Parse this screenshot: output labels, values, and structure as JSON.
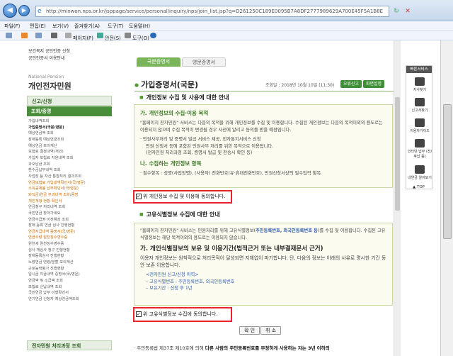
{
  "browser": {
    "back": "◀",
    "forward": "▶",
    "url": "http://minwon.nps.or.kr/jsppage/service/personal/inquiry/nps/join_list.jsp?q=D261250C189E0095B7A8DF2777989629A700E45F5A1B8E",
    "menu": [
      "파일(F)",
      "편집(E)",
      "보기(V)",
      "즐겨찾기(A)",
      "도구(T)",
      "도움말(H)"
    ],
    "toolbar": [
      "페이지(P)",
      "안전(S)",
      "도구(O)"
    ]
  },
  "leftnav": {
    "top_links": [
      "보건복지 공인인증 신청",
      "공인인증서 이용안내"
    ],
    "org": "National Pension",
    "brand": "개인전자민원",
    "sections": [
      "신고/신청",
      "조회/증명",
      "전자민원 처리과정 조회"
    ],
    "items": [
      {
        "label": "가입내역조회",
        "style": ""
      },
      {
        "label": "가입증명서(국문/영문)",
        "style": "bd"
      },
      {
        "label": "예상연금액 조회",
        "style": ""
      },
      {
        "label": "장애등록 예상연금조회",
        "style": ""
      },
      {
        "label": "예상연금 모의계산",
        "style": ""
      },
      {
        "label": "보험료 결정내역(개인)",
        "style": ""
      },
      {
        "label": "가입자 보험료 지원내역 조회",
        "style": ""
      },
      {
        "label": "과오납금 조회",
        "style": ""
      },
      {
        "label": "환수금납부내역 조회",
        "style": ""
      },
      {
        "label": "사업장 등 자산 통합처리 결과조회",
        "style": ""
      },
      {
        "label": "연금보험료 가입내역확인서(국/영문)",
        "style": "hl"
      },
      {
        "label": "소득공제용 납부확인서(국/영문)",
        "style": "hl"
      },
      {
        "label": "퇴직금/연금 부과내역 조회/증명",
        "style": "hl"
      },
      {
        "label": "개인계정 현황 확인서",
        "style": "hl"
      },
      {
        "label": "연금청구 처리내역 조회",
        "style": ""
      },
      {
        "label": "국민연금 찾아가세요",
        "style": ""
      },
      {
        "label": "연금수급권 이전예상 조회",
        "style": ""
      },
      {
        "label": "장애 등록 연금 심사 진행현황",
        "style": ""
      },
      {
        "label": "연금지급내역 증명서(국/영문)",
        "style": "hl"
      },
      {
        "label": "연금수령 원천징수영수증",
        "style": "hl"
      },
      {
        "label": "원천세 원천징수영수증",
        "style": ""
      },
      {
        "label": "심사 재심사 청구 진행현황",
        "style": ""
      },
      {
        "label": "장애등록심사 진행현황",
        "style": ""
      },
      {
        "label": "노령연금 연령/분할 모의계산",
        "style": ""
      },
      {
        "label": "근로능력평가 진행현황",
        "style": ""
      },
      {
        "label": "일시금 지급내역 증명서(국/영문)",
        "style": ""
      },
      {
        "label": "연금액 및 소급액 조회",
        "style": ""
      },
      {
        "label": "보험료 신납내역 조회",
        "style": ""
      },
      {
        "label": "국민연금 납부 이행확인서",
        "style": ""
      },
      {
        "label": "연기연금 신청자 예상연금액조회",
        "style": ""
      }
    ]
  },
  "tabs": [
    "국문증명서",
    "영문증명서"
  ],
  "page_title": "가입증명서(국문)",
  "views": "조회일 : 2018년 10월 10일 (11:30)",
  "buttons_top": [
    "오류신고",
    "화면설명"
  ],
  "section1": {
    "title": "개인정보 수집 및 사용에 대한 안내",
    "h1": "가. 개인정보의 수집·이용 목적",
    "p1": "\"홈페이지 전자민원\" 서비스는 다음의 목적을 위해 개인정보를 수집 및 이용합니다. 수집된 개인정보는 다음의 목적이외의 용도로는 이용되지 않으며 수집 목적이 변경될 경우 사전에 알리고 동의를 받을 예정입니다.",
    "p2": "· 민원사무처리 및 증명서 발급 서비스 제공, 전자통지서비스 신청",
    "p3": "민원 신청서 등에 포함된 민원사무 처리를 위한 목적으로 이용됩니다.",
    "p4": "(전자민원 처리과정 조회, 증명서 발급 및 전송시 확인 등)",
    "h2": "나. 수집하는 개인정보 항목",
    "p5": "· 필수항목 : 성명(사업장명), (사용자) 전화번호(유·휴대전화번호), 민원신청서상의 필수입력 항목"
  },
  "agree1": "위 개인정보 수집 및 이용에 동의합니다.",
  "section2": {
    "title": "고유식별정보 수집에 대한 안내",
    "p1a": "\"홈페이지 전자민원\" 서비스는 민원처리를 위해 고유식별정보(",
    "p1b": "주민등록번호, 외국인등록번호 등",
    "p1c": ")를 수집 및 이용합니다. 수집된 고유식별정보는 해당 목적이외의 용도로는 이용되지 않습니다.",
    "h": "가. 개인식별정보의 보유 및 이용기간(법적근거 또는 내부결재문서 근거)",
    "p2": "이용자 개인정보는 원칙적으로 처리목적이 달성되면 지체없이 파기합니다. 단, 다음의 정보는 아래의 사유로 명시한 기간 동안 보존 이용합니다.",
    "l1": "<전자민원 신고/신청 이력>",
    "l2": "– 고유식별번호 : 주민등록번호, 외국인등록번호",
    "l3": "– 보유기간 : 신청 후 1년"
  },
  "agree2": "위 고유식별정보 수집에 동의합니다.",
  "confirm": "확 인",
  "cancel": "취 소",
  "footnote_a": "· 주민등록법 제37조 제10호에 의해",
  "footnote_b": " 다른 사람의 주민등록번호를 부정하게 사용하는 자는 3년 이하의",
  "quick": {
    "header": "빠른서비스",
    "items": [
      "지사찾기",
      "신고서찾기",
      "이용자가이드",
      "인터넷 납부 (전/후납 등)",
      "내연금 알아보기"
    ],
    "top": "TOP"
  }
}
